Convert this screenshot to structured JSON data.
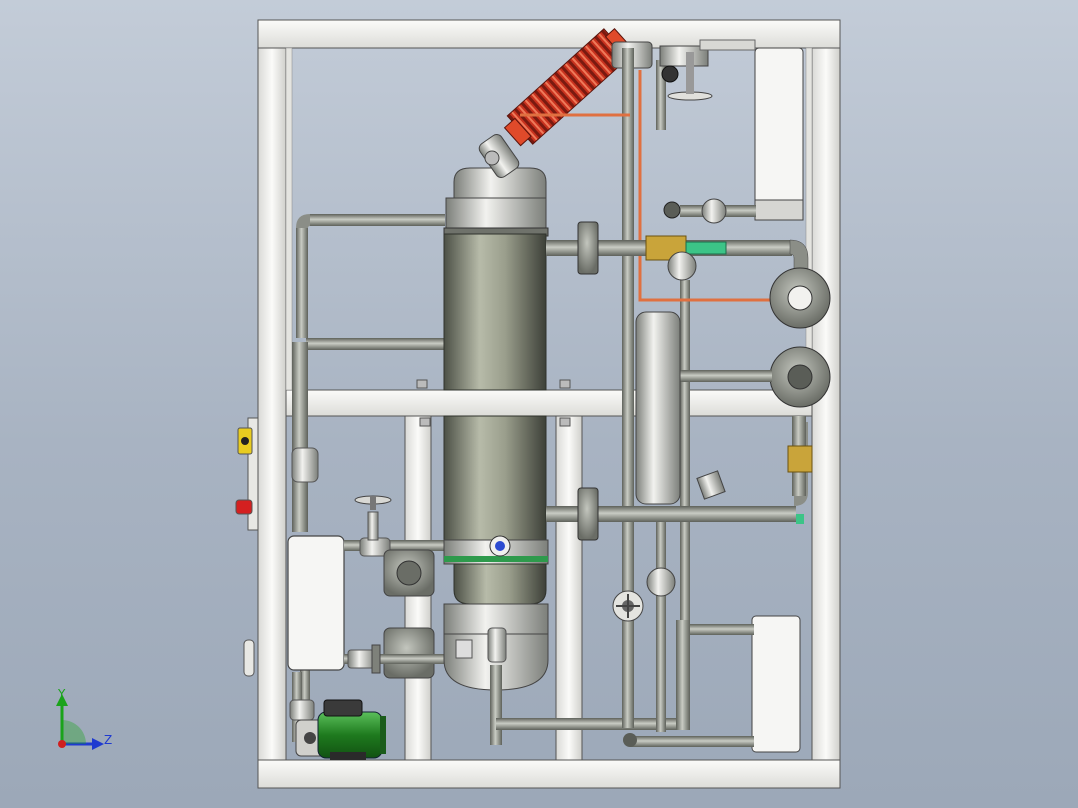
{
  "view": {
    "background_top": "#c3ccd8",
    "background_bottom": "#9ca8b8"
  },
  "axes": {
    "y_label": "Y",
    "z_label": "Z",
    "y_color": "#1aa31a",
    "z_color": "#1f3ad0",
    "origin_color": "#d01f1f"
  },
  "colors": {
    "frame": "#f4f4f2",
    "frame_edge": "#555555",
    "pipe": "#8b8e87",
    "pipe_dark": "#5a5d57",
    "vessel": "#8d9182",
    "coil": "#c8321e",
    "coil_hot": "#e04a2a",
    "pump": "#2f8f2f",
    "brass": "#c9a43a",
    "alarm_red": "#d42020",
    "alarm_yellow": "#e8cc20",
    "level_green": "#3cc487",
    "copper": "#e07040"
  },
  "icons": {
    "axis_triad": "triad-icon",
    "pump": "pump-icon",
    "handwheel": "handwheel-icon",
    "indicator_light": "indicator-light-icon"
  }
}
